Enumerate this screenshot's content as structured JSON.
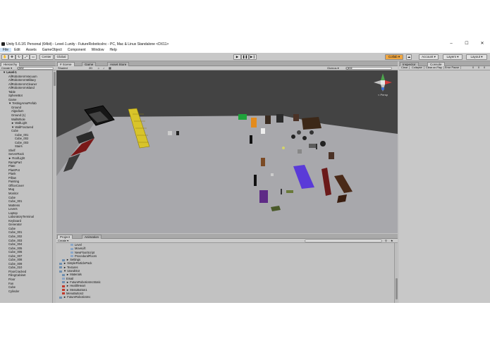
{
  "window": {
    "title": "Unity 5.6.1f1 Personal (64bit) - Level-1.unity - FutureRoboticsInc - PC, Mac & Linux Standalone <DX11>",
    "controls": [
      "–",
      "☐",
      "✕"
    ]
  },
  "menu": [
    "File",
    "Edit",
    "Assets",
    "GameObject",
    "Component",
    "Window",
    "Help"
  ],
  "toolbar": {
    "center": "Center",
    "global": "Global",
    "play": "▶",
    "pause": "❚❚",
    "step": "▶❙",
    "collab": "Collab ▾",
    "account": "Account ▾",
    "layers": "Layers ▾",
    "layout": "Layout ▾"
  },
  "hierarchy": {
    "tab": "Hierarchy",
    "create": "Create ▾",
    "search": "Q▾All",
    "items": [
      "▼ Level-1",
      "AllRobotsArmVacuum",
      "AllRobotsArmMilitary",
      "AllRobotsArmCleaner",
      "AllRobotsArmIsland",
      "Table",
      "SphereBot",
      "Game",
      "▼ TestingAreaPrefab",
      "Ground",
      "Algodium",
      "Ground (1)",
      "WallWhole",
      "► WallLight",
      "▼ WallFractured",
      "Cube",
      "Cube_001",
      "Cube_002",
      "Cube_003",
      "Stairs",
      "Shelf",
      "ServerRack",
      "► RoofLight",
      "RampPart",
      "Plate",
      "PlantPot",
      "Plank",
      "Pillow",
      "Painting",
      "OfficeCover",
      "Mug",
      "Monitor",
      "Cube",
      "Cube_001",
      "Mattress",
      "Levers",
      "Laptop",
      "LaboratoryTerminal",
      "Keyboard",
      "Generator",
      "Cube",
      "Cube_001",
      "Cube_002",
      "Cube_003",
      "Cube_004",
      "Cube_005",
      "Cube_006",
      "Cube_007",
      "Cube_008",
      "Cube_009",
      "Cube_010",
      "FloorCracked",
      "FilingCabinet",
      "Floor",
      "Fan",
      "Cube",
      "Cylinder"
    ]
  },
  "scene": {
    "tabs": [
      "# Scene",
      "Game",
      "Asset Store"
    ],
    "shaded": "Shaded",
    "mode": "2D",
    "gizmos": "Gizmos ▾",
    "search": "Q▾All",
    "persp": "< Persp"
  },
  "inspector": {
    "tabs": [
      "Inspector",
      "Console"
    ],
    "buttons": [
      "Clear",
      "Collapse",
      "Clear on Play",
      "Error Pause"
    ],
    "counts": [
      "0",
      "0",
      "0"
    ]
  },
  "project": {
    "tabs": [
      "Project",
      "Animation"
    ],
    "create": "Create ▾",
    "items": [
      "Level",
      "MoveLift",
      "NewFloorScript",
      "ProceduralFloors",
      "► Settings",
      "► SimpleParticlePack",
      "► Textures",
      "▼ UIandGUI",
      "► Materials",
      "Email",
      "► FutureRoboticsIncStatic",
      "► HealthHeart",
      "► MenuButton1",
      "MenuButton2",
      "► FutureRoboticsInc"
    ]
  },
  "colors": {
    "floor": "#a8a8ac",
    "viewport": "#434343",
    "panel": "#c2c2c2",
    "mat": "#5a3ad8"
  }
}
